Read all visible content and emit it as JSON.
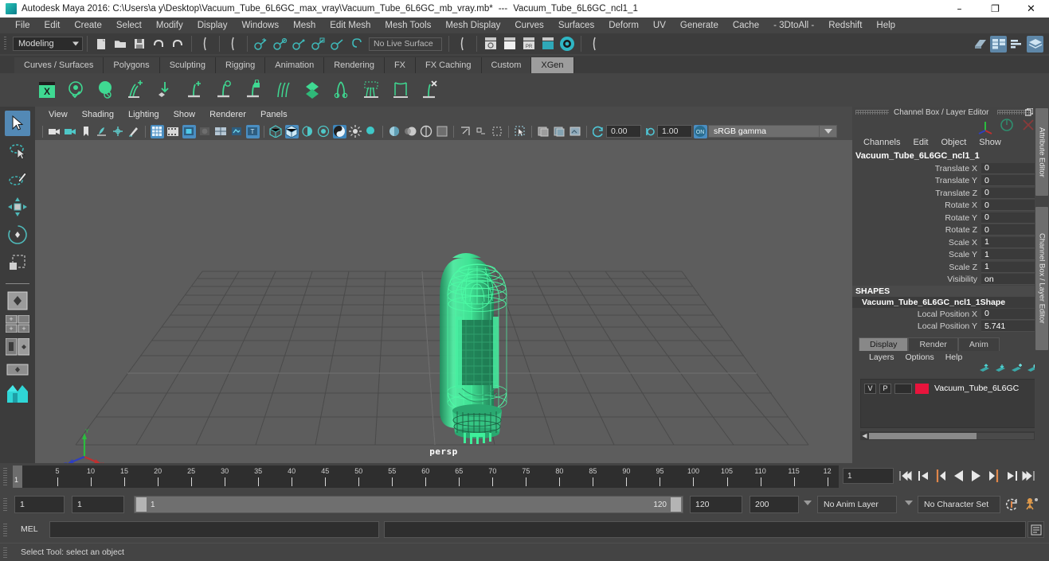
{
  "window": {
    "app_icon": "maya-app-icon",
    "title": "Autodesk Maya 2016: C:\\Users\\a y\\Desktop\\Vacuum_Tube_6L6GC_max_vray\\Vacuum_Tube_6L6GC_mb_vray.mb*",
    "separator": "---",
    "subtitle": "Vacuum_Tube_6L6GC_ncl1_1",
    "minimize": "–",
    "maximize": "❐",
    "close": "✕"
  },
  "menubar": {
    "items": [
      "File",
      "Edit",
      "Create",
      "Select",
      "Modify",
      "Display",
      "Windows",
      "Mesh",
      "Edit Mesh",
      "Mesh Tools",
      "Mesh Display",
      "Curves",
      "Surfaces",
      "Deform",
      "UV",
      "Generate",
      "Cache",
      "- 3DtoAll -",
      "Redshift",
      "Help"
    ]
  },
  "statusbar": {
    "mode": "Modeling",
    "live_surface": "No Live Surface",
    "icons": [
      "new-scene-icon",
      "open-scene-icon",
      "save-scene-icon",
      "undo-icon",
      "redo-icon",
      "select-by-hierarchy-icon",
      "select-by-object-icon",
      "select-by-component-icon",
      "snap-grid-icon",
      "snap-curve-icon",
      "snap-point-icon",
      "snap-view-plane-icon",
      "snap-live-icon",
      "construction-history-icon",
      "render-current-frame-icon",
      "ipr-render-icon",
      "render-settings-icon",
      "hypershade-icon",
      "render-view-icon"
    ],
    "right_icons": [
      "sidebar-toggle-icon",
      "attribute-editor-icon",
      "tool-settings-icon",
      "channel-box-icon"
    ]
  },
  "shelf": {
    "tabs": [
      "Curves / Surfaces",
      "Polygons",
      "Sculpting",
      "Rigging",
      "Animation",
      "Rendering",
      "FX",
      "FX Caching",
      "Custom",
      "XGen"
    ],
    "active_tab": "XGen",
    "icons": [
      "xgen-editor-icon",
      "xgen-preview-icon",
      "xgen-sphere-icon",
      "xgen-add-hair-icon",
      "xgen-place-icon",
      "xgen-add-guide-icon",
      "xgen-select-guide-icon",
      "xgen-lock-guide-icon",
      "xgen-comb-icon",
      "xgen-density-icon",
      "xgen-cut-icon",
      "xgen-clump-icon",
      "xgen-noise-icon",
      "xgen-delete-guide-icon"
    ]
  },
  "toolbox": {
    "tools": [
      "select-tool",
      "lasso-select-tool",
      "paint-select-tool",
      "move-tool",
      "rotate-tool",
      "scale-tool"
    ],
    "active_tool": "select-tool",
    "layouts": [
      "single-perspective-layout",
      "four-view-layout",
      "persp-outliner-layout",
      "persp-graph-layout",
      "hypershade-layout"
    ]
  },
  "viewport": {
    "menus": [
      "View",
      "Shading",
      "Lighting",
      "Show",
      "Renderer",
      "Panels"
    ],
    "camera_label": "persp",
    "exposure": "0.00",
    "gamma": "1.00",
    "color_space": "sRGB gamma",
    "toolbar_icons": [
      "camera-select-icon",
      "camera-attributes-icon",
      "bookmark-icon",
      "image-plane-icon",
      "2d-pan-zoom-icon",
      "grease-pencil-icon",
      "grid-toggle-icon",
      "film-gate-icon",
      "resolution-gate-icon",
      "gate-mask-icon",
      "film-origin-icon",
      "safe-action-icon",
      "title-safe-icon",
      "wireframe-shading-icon",
      "smooth-shade-all-icon",
      "shade-with-wireframe-icon",
      "use-default-material-icon",
      "textured-icon",
      "use-all-lights-icon",
      "shadows-icon",
      "ambient-occlusion-icon",
      "motion-blur-icon",
      "multisample-icon",
      "isolate-select-icon",
      "xray-icon",
      "xray-joints-icon",
      "xray-active-components-icon"
    ],
    "object": {
      "name": "Vacuum_Tube_6L6GC_ncl1_1",
      "wireframe_color": "#3ef09a",
      "selected": true
    },
    "axis_gizmo": {
      "x": "#cc3333",
      "y": "#33cc44",
      "z": "#3344cc"
    }
  },
  "channel_box": {
    "panel_title": "Channel Box / Layer Editor",
    "menus": [
      "Channels",
      "Edit",
      "Object",
      "Show"
    ],
    "node_name": "Vacuum_Tube_6L6GC_ncl1_1",
    "attributes": [
      {
        "label": "Translate X",
        "value": "0"
      },
      {
        "label": "Translate Y",
        "value": "0"
      },
      {
        "label": "Translate Z",
        "value": "0"
      },
      {
        "label": "Rotate X",
        "value": "0"
      },
      {
        "label": "Rotate Y",
        "value": "0"
      },
      {
        "label": "Rotate Z",
        "value": "0"
      },
      {
        "label": "Scale X",
        "value": "1"
      },
      {
        "label": "Scale Y",
        "value": "1"
      },
      {
        "label": "Scale Z",
        "value": "1"
      },
      {
        "label": "Visibility",
        "value": "on"
      }
    ],
    "shapes_header": "SHAPES",
    "shape_name": "Vacuum_Tube_6L6GC_ncl1_1Shape",
    "shape_attributes": [
      {
        "label": "Local Position X",
        "value": "0"
      },
      {
        "label": "Local Position Y",
        "value": "5.741"
      }
    ]
  },
  "layer_editor": {
    "tabs": [
      "Display",
      "Render",
      "Anim"
    ],
    "active_tab": "Display",
    "menus": [
      "Layers",
      "Options",
      "Help"
    ],
    "toolbar_icons": [
      "move-layer-up-icon",
      "move-layer-down-icon",
      "create-empty-layer-icon",
      "create-layer-from-selected-icon"
    ],
    "layers": [
      {
        "visibility": "V",
        "playback": "P",
        "state": "",
        "color": "#e8143c",
        "name": "Vacuum_Tube_6L6GC"
      }
    ]
  },
  "vertical_tabs": [
    "Attribute Editor",
    "Channel Box / Layer Editor"
  ],
  "timeline": {
    "ticks": [
      "5",
      "10",
      "15",
      "20",
      "25",
      "30",
      "35",
      "40",
      "45",
      "50",
      "55",
      "60",
      "65",
      "70",
      "75",
      "80",
      "85",
      "90",
      "95",
      "100",
      "105",
      "110",
      "115",
      "12"
    ],
    "current_frame": "1",
    "current_frame_field": "1",
    "playback_buttons": [
      "go-to-start-icon",
      "step-back-keyframe-icon",
      "step-back-frame-icon",
      "play-backwards-icon",
      "play-forwards-icon",
      "step-forward-frame-icon",
      "step-forward-keyframe-icon",
      "go-to-end-icon"
    ]
  },
  "range_slider": {
    "anim_start": "1",
    "playback_start": "1",
    "slider_start_label": "1",
    "slider_end_label": "120",
    "playback_end": "120",
    "anim_end": "200",
    "anim_layer": "No Anim Layer",
    "character_set": "No Character Set",
    "icons": [
      "auto-keyframe-icon",
      "animation-preferences-icon"
    ]
  },
  "command_line": {
    "label": "MEL",
    "input_value": "",
    "output_value": "",
    "script_editor_icon": "script-editor-icon"
  },
  "status_line": {
    "text": "Select Tool: select an object"
  }
}
